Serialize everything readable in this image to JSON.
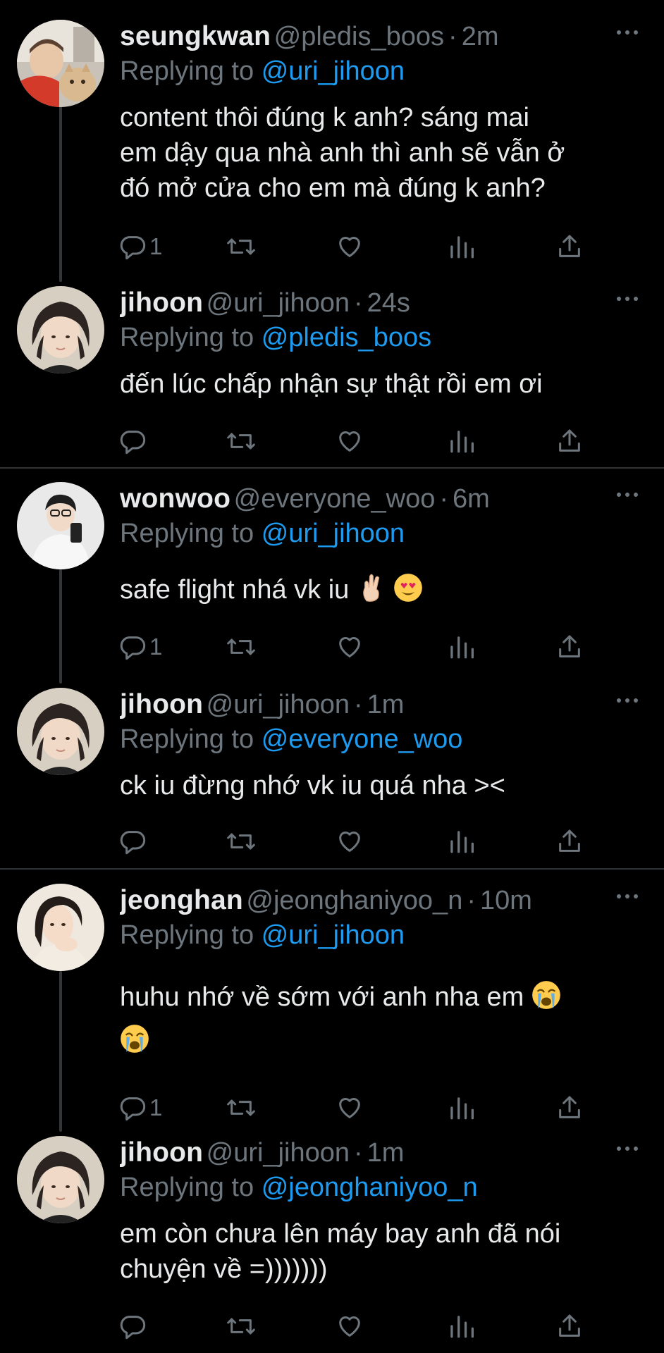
{
  "tweets": [
    {
      "name": "seungkwan",
      "handle": "@pledis_boos",
      "dot": "·",
      "time": "2m",
      "replying_label": "Replying to",
      "replying_to": "@uri_jihoon",
      "lines": [
        "content thôi đúng k anh? sáng mai",
        "em dậy qua nhà anh thì anh sẽ vẫn ở",
        "đó mở cửa cho em mà đúng k anh?"
      ],
      "reply_count": "1",
      "avatar": "avatar-seungkwan"
    },
    {
      "name": "jihoon",
      "handle": "@uri_jihoon",
      "dot": "·",
      "time": "24s",
      "replying_label": "Replying to",
      "replying_to": "@pledis_boos",
      "lines": [
        "đến lúc chấp nhận sự thật rồi em ơi"
      ],
      "reply_count": "",
      "avatar": "avatar-jihoon"
    },
    {
      "name": "wonwoo",
      "handle": "@everyone_woo",
      "dot": "·",
      "time": "6m",
      "replying_label": "Replying to",
      "replying_to": "@uri_jihoon",
      "lines": [
        "safe flight nhá vk iu"
      ],
      "emojis": [
        "crossed-fingers-emoji",
        "heart-eyes-emoji"
      ],
      "reply_count": "1",
      "avatar": "avatar-wonwoo"
    },
    {
      "name": "jihoon",
      "handle": "@uri_jihoon",
      "dot": "·",
      "time": "1m",
      "replying_label": "Replying to",
      "replying_to": "@everyone_woo",
      "lines": [
        "ck iu đừng nhớ vk iu quá nha ><"
      ],
      "reply_count": "",
      "avatar": "avatar-jihoon"
    },
    {
      "name": "jeonghan",
      "handle": "@jeonghaniyoo_n",
      "dot": "·",
      "time": "10m",
      "replying_label": "Replying to",
      "replying_to": "@uri_jihoon",
      "lines": [
        "huhu nhớ về sớm với anh nha em"
      ],
      "emojis": [
        "crying-emoji",
        "crying-emoji"
      ],
      "reply_count": "1",
      "avatar": "avatar-jeonghan"
    },
    {
      "name": "jihoon",
      "handle": "@uri_jihoon",
      "dot": "·",
      "time": "1m",
      "replying_label": "Replying to",
      "replying_to": "@jeonghaniyoo_n",
      "lines": [
        "em còn chưa lên máy bay anh đã nói",
        "chuyện về =)))))))"
      ],
      "reply_count": "",
      "avatar": "avatar-jihoon"
    }
  ],
  "icons": {
    "reply": "reply-icon",
    "retweet": "retweet-icon",
    "like": "like-icon",
    "analytics": "analytics-icon",
    "share": "share-icon",
    "more": "more-icon"
  },
  "colors": {
    "background": "#000000",
    "text": "#e7e9ea",
    "secondary": "#6e767d",
    "mention": "#1d9bf0",
    "divider": "#2f3336"
  }
}
